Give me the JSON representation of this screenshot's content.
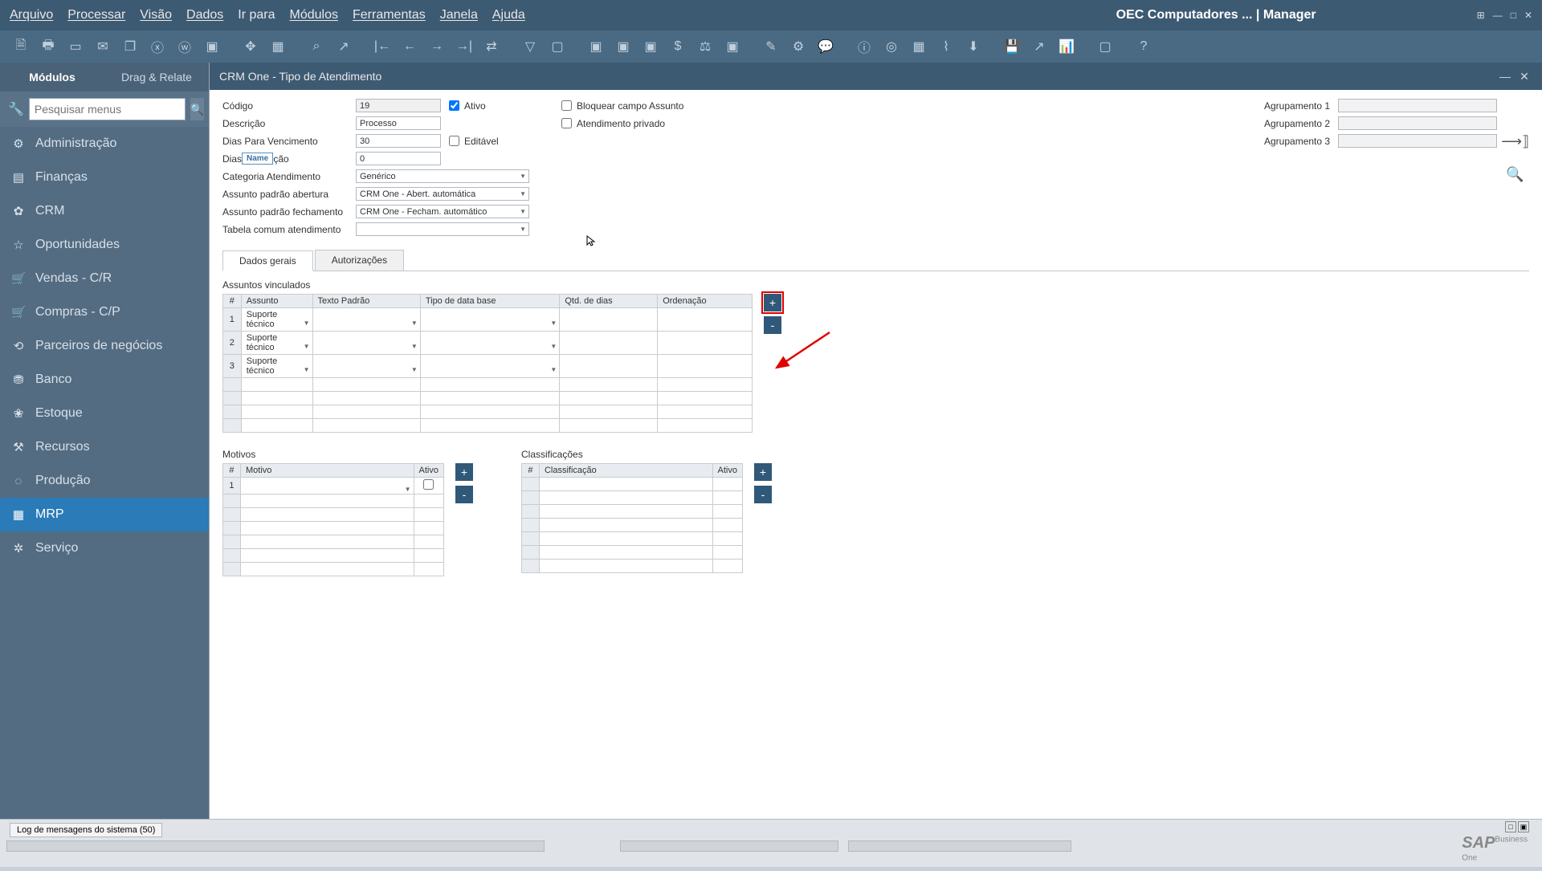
{
  "menubar": {
    "items": [
      "Arquivo",
      "Processar",
      "Visão",
      "Dados",
      "Ir para",
      "Módulos",
      "Ferramentas",
      "Janela",
      "Ajuda"
    ],
    "app_title": "OEC Computadores ... | Manager"
  },
  "sidebar": {
    "tabs": {
      "modules": "Módulos",
      "drag": "Drag & Relate"
    },
    "search_placeholder": "Pesquisar menus",
    "items": [
      {
        "icon": "⚙",
        "label": "Administração"
      },
      {
        "icon": "▤",
        "label": "Finanças"
      },
      {
        "icon": "✿",
        "label": "CRM"
      },
      {
        "icon": "☆",
        "label": "Oportunidades"
      },
      {
        "icon": "🛒",
        "label": "Vendas - C/R"
      },
      {
        "icon": "🛒",
        "label": "Compras - C/P"
      },
      {
        "icon": "⟲",
        "label": "Parceiros de negócios"
      },
      {
        "icon": "⛃",
        "label": "Banco"
      },
      {
        "icon": "❀",
        "label": "Estoque"
      },
      {
        "icon": "⚒",
        "label": "Recursos"
      },
      {
        "icon": "◌",
        "label": "Produção"
      },
      {
        "icon": "▦",
        "label": "MRP"
      },
      {
        "icon": "✲",
        "label": "Serviço"
      }
    ]
  },
  "window": {
    "title": "CRM One - Tipo de Atendimento",
    "fields": {
      "codigo_label": "Código",
      "codigo": "19",
      "ativo_label": "Ativo",
      "descricao_label": "Descrição",
      "descricao": "Processo",
      "dias_venc_label": "Dias Para Vencimento",
      "dias_venc": "30",
      "editavel_label": "Editável",
      "dias_label": "Dias",
      "dias_suffix": "ção",
      "dias": "0",
      "name_bubble": "Name",
      "categoria_label": "Categoria Atendimento",
      "categoria": "Genérico",
      "assunto_abert_label": "Assunto padrão abertura",
      "assunto_abert": "CRM One - Abert. automática",
      "assunto_fech_label": "Assunto padrão fechamento",
      "assunto_fech": "CRM One - Fecham. automático",
      "tabela_label": "Tabela comum atendimento",
      "tabela": "",
      "bloquear_label": "Bloquear campo Assunto",
      "atend_priv_label": "Atendimento privado",
      "agr1_label": "Agrupamento 1",
      "agr2_label": "Agrupamento 2",
      "agr3_label": "Agrupamento 3"
    },
    "tabs": {
      "dados": "Dados gerais",
      "autorizacoes": "Autorizações"
    },
    "assuntos": {
      "title": "Assuntos vinculados",
      "headers": {
        "num": "#",
        "assunto": "Assunto",
        "texto": "Texto Padrão",
        "tipodata": "Tipo de data base",
        "qtd": "Qtd. de dias",
        "ord": "Ordenação"
      },
      "rows": [
        {
          "num": "1",
          "assunto": "Suporte técnico"
        },
        {
          "num": "2",
          "assunto": "Suporte técnico"
        },
        {
          "num": "3",
          "assunto": "Suporte técnico"
        }
      ]
    },
    "motivos": {
      "title": "Motivos",
      "headers": {
        "num": "#",
        "motivo": "Motivo",
        "ativo": "Ativo"
      },
      "rows": [
        {
          "num": "1"
        }
      ]
    },
    "classificacoes": {
      "title": "Classificações",
      "headers": {
        "num": "#",
        "cls": "Classificação",
        "ativo": "Ativo"
      }
    }
  },
  "statusbar": {
    "log": "Log de mensagens do sistema (50)",
    "brand": "SAP",
    "brand2": "Business",
    "brand3": "One"
  }
}
